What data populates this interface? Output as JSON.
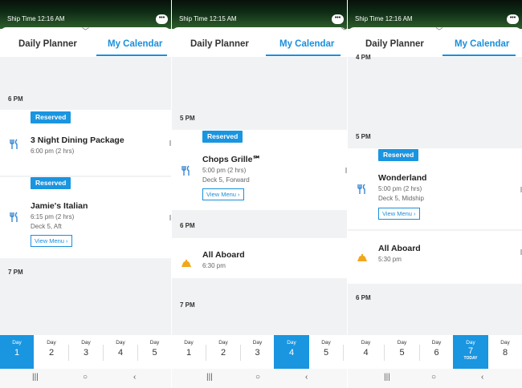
{
  "screens": [
    {
      "ship_time": "Ship Time 12:16 AM",
      "tabs": [
        "Daily Planner",
        "My Calendar"
      ],
      "times": [
        "6 PM",
        "7 PM"
      ],
      "events": [
        {
          "badge": "Reserved",
          "title": "3 Night Dining Package",
          "time": "6:00 pm (2 hrs)"
        },
        {
          "badge": "Reserved",
          "title": "Jamie's Italian",
          "time": "6:15 pm (2 hrs)",
          "location": "Deck 5, Aft",
          "button": "View Menu ›"
        }
      ],
      "days": [
        {
          "label": "Day",
          "num": "1"
        },
        {
          "label": "Day",
          "num": "2"
        },
        {
          "label": "Day",
          "num": "3"
        },
        {
          "label": "Day",
          "num": "4"
        },
        {
          "label": "Day",
          "num": "5"
        }
      ]
    },
    {
      "ship_time": "Ship Time 12:15 AM",
      "tabs": [
        "Daily Planner",
        "My Calendar"
      ],
      "times": [
        "5 PM",
        "6 PM",
        "7 PM"
      ],
      "events": [
        {
          "badge": "Reserved",
          "title": "Chops Grille℠",
          "time": "5:00 pm (2 hrs)",
          "location": "Deck 5, Forward",
          "button": "View Menu ›"
        },
        {
          "title": "All Aboard",
          "time": "6:30 pm"
        }
      ],
      "days": [
        {
          "label": "Day",
          "num": "1"
        },
        {
          "label": "Day",
          "num": "2"
        },
        {
          "label": "Day",
          "num": "3"
        },
        {
          "label": "Day",
          "num": "4"
        },
        {
          "label": "Day",
          "num": "5"
        }
      ]
    },
    {
      "ship_time": "Ship Time 12:16 AM",
      "tabs": [
        "Daily Planner",
        "My Calendar"
      ],
      "times": [
        "4 PM",
        "5 PM",
        "6 PM"
      ],
      "events": [
        {
          "badge": "Reserved",
          "title": "Wonderland",
          "time": "5:00 pm (2 hrs)",
          "location": "Deck 5, Midship",
          "button": "View Menu ›"
        },
        {
          "title": "All Aboard",
          "time": "5:30 pm"
        }
      ],
      "days": [
        {
          "label": "Day",
          "num": "4"
        },
        {
          "label": "Day",
          "num": "5"
        },
        {
          "label": "Day",
          "num": "6"
        },
        {
          "label": "Day",
          "num": "7",
          "sub": "TODAY"
        },
        {
          "label": "Day",
          "num": "8"
        }
      ]
    }
  ],
  "icons": {
    "chat": "chat-bubble-icon",
    "chevron": "chevron-down-icon",
    "dining": "fork-knife-icon",
    "boarding": "ship-bell-icon",
    "nav_recent": "recent-apps-icon",
    "nav_home": "home-circle-icon",
    "nav_back": "back-chevron-icon"
  },
  "colors": {
    "accent": "#1a95e0",
    "status_bar": "#0d2a15",
    "background": "#f1f2f4",
    "all_aboard_icon": "#f2a71b"
  }
}
